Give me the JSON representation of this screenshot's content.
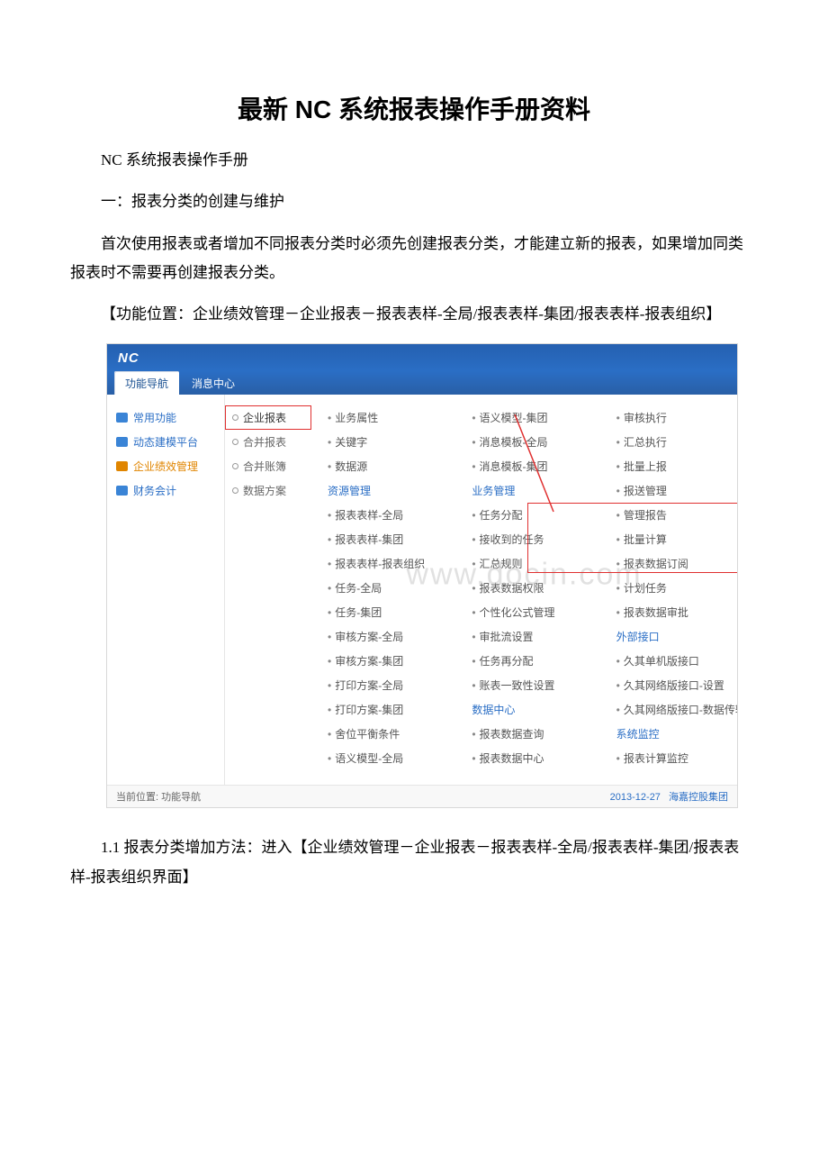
{
  "title": "最新 NC 系统报表操作手册资料",
  "p1": "NC 系统报表操作手册",
  "p2": "一：报表分类的创建与维护",
  "p3": "首次使用报表或者增加不同报表分类时必须先创建报表分类，才能建立新的报表，如果增加同类报表时不需要再创建报表分类。",
  "p4": "【功能位置：企业绩效管理－企业报表－报表表样-全局/报表表样-集团/报表表样-报表组织】",
  "p5": "1.1 报表分类增加方法：进入【企业绩效管理－企业报表－报表表样-全局/报表表样-集团/报表表样-报表组织界面】",
  "screenshot": {
    "logo": "NC",
    "tabs": {
      "t1": "功能导航",
      "t2": "消息中心"
    },
    "left": {
      "i1": "常用功能",
      "i2": "动态建模平台",
      "i3": "企业绩效管理",
      "i4": "财务会计"
    },
    "sub": {
      "s1": "企业报表",
      "s2": "合并报表",
      "s3": "合并账簿",
      "s4": "数据方案"
    },
    "col1": {
      "c1": "业务属性",
      "c2": "关键字",
      "c3": "数据源",
      "h1": "资源管理",
      "c4": "报表表样-全局",
      "c5": "报表表样-集团",
      "c6": "报表表样-报表组织",
      "c7": "任务-全局",
      "c8": "任务-集团",
      "c9": "审核方案-全局",
      "c10": "审核方案-集团",
      "c11": "打印方案-全局",
      "c12": "打印方案-集团",
      "c13": "舍位平衡条件",
      "c14": "语义模型-全局"
    },
    "col2": {
      "c1": "语义模型-集团",
      "c2": "消息模板-全局",
      "c3": "消息模板-集团",
      "h1": "业务管理",
      "c4": "任务分配",
      "c5": "接收到的任务",
      "c6": "汇总规则",
      "c7": "报表数据权限",
      "c8": "个性化公式管理",
      "c9": "审批流设置",
      "c10": "任务再分配",
      "c11": "账表一致性设置",
      "h2": "数据中心",
      "c12": "报表数据查询",
      "c13": "报表数据中心"
    },
    "col3": {
      "c1": "审核执行",
      "c2": "汇总执行",
      "c3": "批量上报",
      "c4": "报送管理",
      "c5": "管理报告",
      "c6": "批量计算",
      "c7": "报表数据订阅",
      "c8": "计划任务",
      "c9": "报表数据审批",
      "h1": "外部接口",
      "c10": "久其单机版接口",
      "c11": "久其网络版接口-设置",
      "c12": "久其网络版接口-数据传输",
      "h2": "系统监控",
      "c13": "报表计算监控"
    },
    "footer": {
      "left": "当前位置: 功能导航",
      "date": "2013-12-27",
      "org": "海嘉控股集团"
    },
    "watermark": "www.docin.com"
  }
}
